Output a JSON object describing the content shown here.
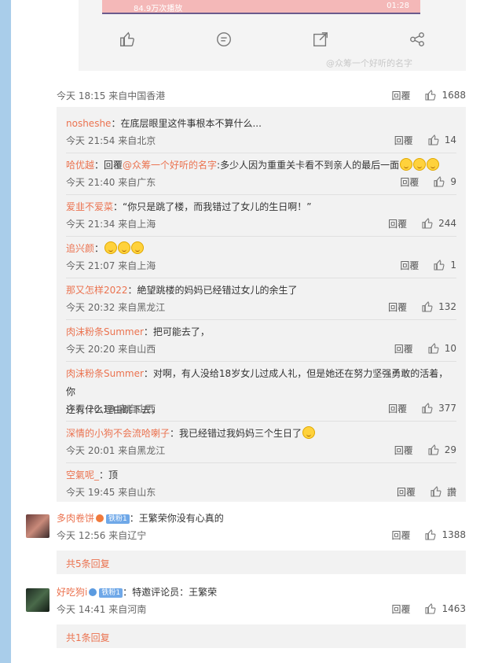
{
  "video": {
    "left_text": "84.9万次播放",
    "right_text": "01:28"
  },
  "watermark": "@众筹一个好听的名字",
  "icon_names": {
    "like": "thumbs-up-icon",
    "comment": "comment-icon",
    "share": "forward-icon",
    "more": "share-icon"
  },
  "main_comment": {
    "meta": "今天 18:15 来自中国香港",
    "reply_label": "回覆",
    "likes": "1688"
  },
  "replies": [
    {
      "name": "nosheshe",
      "text": "：在底层眼里这件事根本不算什么...",
      "meta": "今天 21:54 来自北京",
      "reply_label": "回覆",
      "likes": "14"
    },
    {
      "name": "哈优越",
      "text_prefix": "：回覆",
      "mention": "@众筹一个好听的名字",
      "text": ":多少人因为重重关卡看不到亲人的最后一面",
      "meta": "今天 21:40 来自广东",
      "reply_label": "回覆",
      "likes": "9"
    },
    {
      "name": "爱韭不爱菜",
      "text": "：“你只是跳了楼，而我错过了女儿的生日啊！”",
      "meta": "今天 21:34 来自上海",
      "reply_label": "回覆",
      "likes": "244"
    },
    {
      "name": "追兴颜",
      "text": "：",
      "meta": "今天 21:07 来自上海",
      "reply_label": "回覆",
      "likes": "1"
    },
    {
      "name": "那又怎样2022",
      "text": "：絶望跳楼的妈妈已经错过女儿的余生了",
      "meta": "今天 20:32 来自黑龙江",
      "reply_label": "回覆",
      "likes": "132"
    },
    {
      "name": "肉沫粉条Summer",
      "text": "：把可能去了，",
      "meta": "今天 20:20 来自山西",
      "reply_label": "回覆",
      "likes": "10"
    },
    {
      "name": "肉沫粉条Summer",
      "text": "：对啊，有人没给18岁女儿过成人礼，但是她还在努力坚强勇敢的活着，你",
      "text2": "还有什么理由跳下去，",
      "meta": "今天 20:19 来自山西",
      "reply_label": "回覆",
      "likes": "377"
    },
    {
      "name": "深情的小狗不会流哈喇子",
      "text": "：我已经错过我妈妈三个生日了",
      "meta": "今天 20:01 来自黑龙江",
      "reply_label": "回覆",
      "likes": "29"
    },
    {
      "name": "空氣呢_",
      "text": "：顶",
      "meta": "今天 19:45 来自山东",
      "reply_label": "回覆",
      "likes": "讚"
    }
  ],
  "comment2": {
    "name": "多肉卷饼",
    "badge": "铁粉1",
    "text": "：王繁荣你没有心真的",
    "meta": "今天 12:56 来自辽宁",
    "reply_label": "回覆",
    "likes": "1388",
    "more": "共5条回复"
  },
  "comment3": {
    "name": "好吃狗i",
    "badge": "铁粉1",
    "text": "：特邀评论员：王繁荣",
    "meta": "今天 14:41 来自河南",
    "reply_label": "回覆",
    "likes": "1463",
    "more": "共1条回复"
  },
  "colors": {
    "accent": "#eb7350",
    "sidebar": "#a9cdea",
    "reply_bg": "#f2f2f2"
  }
}
